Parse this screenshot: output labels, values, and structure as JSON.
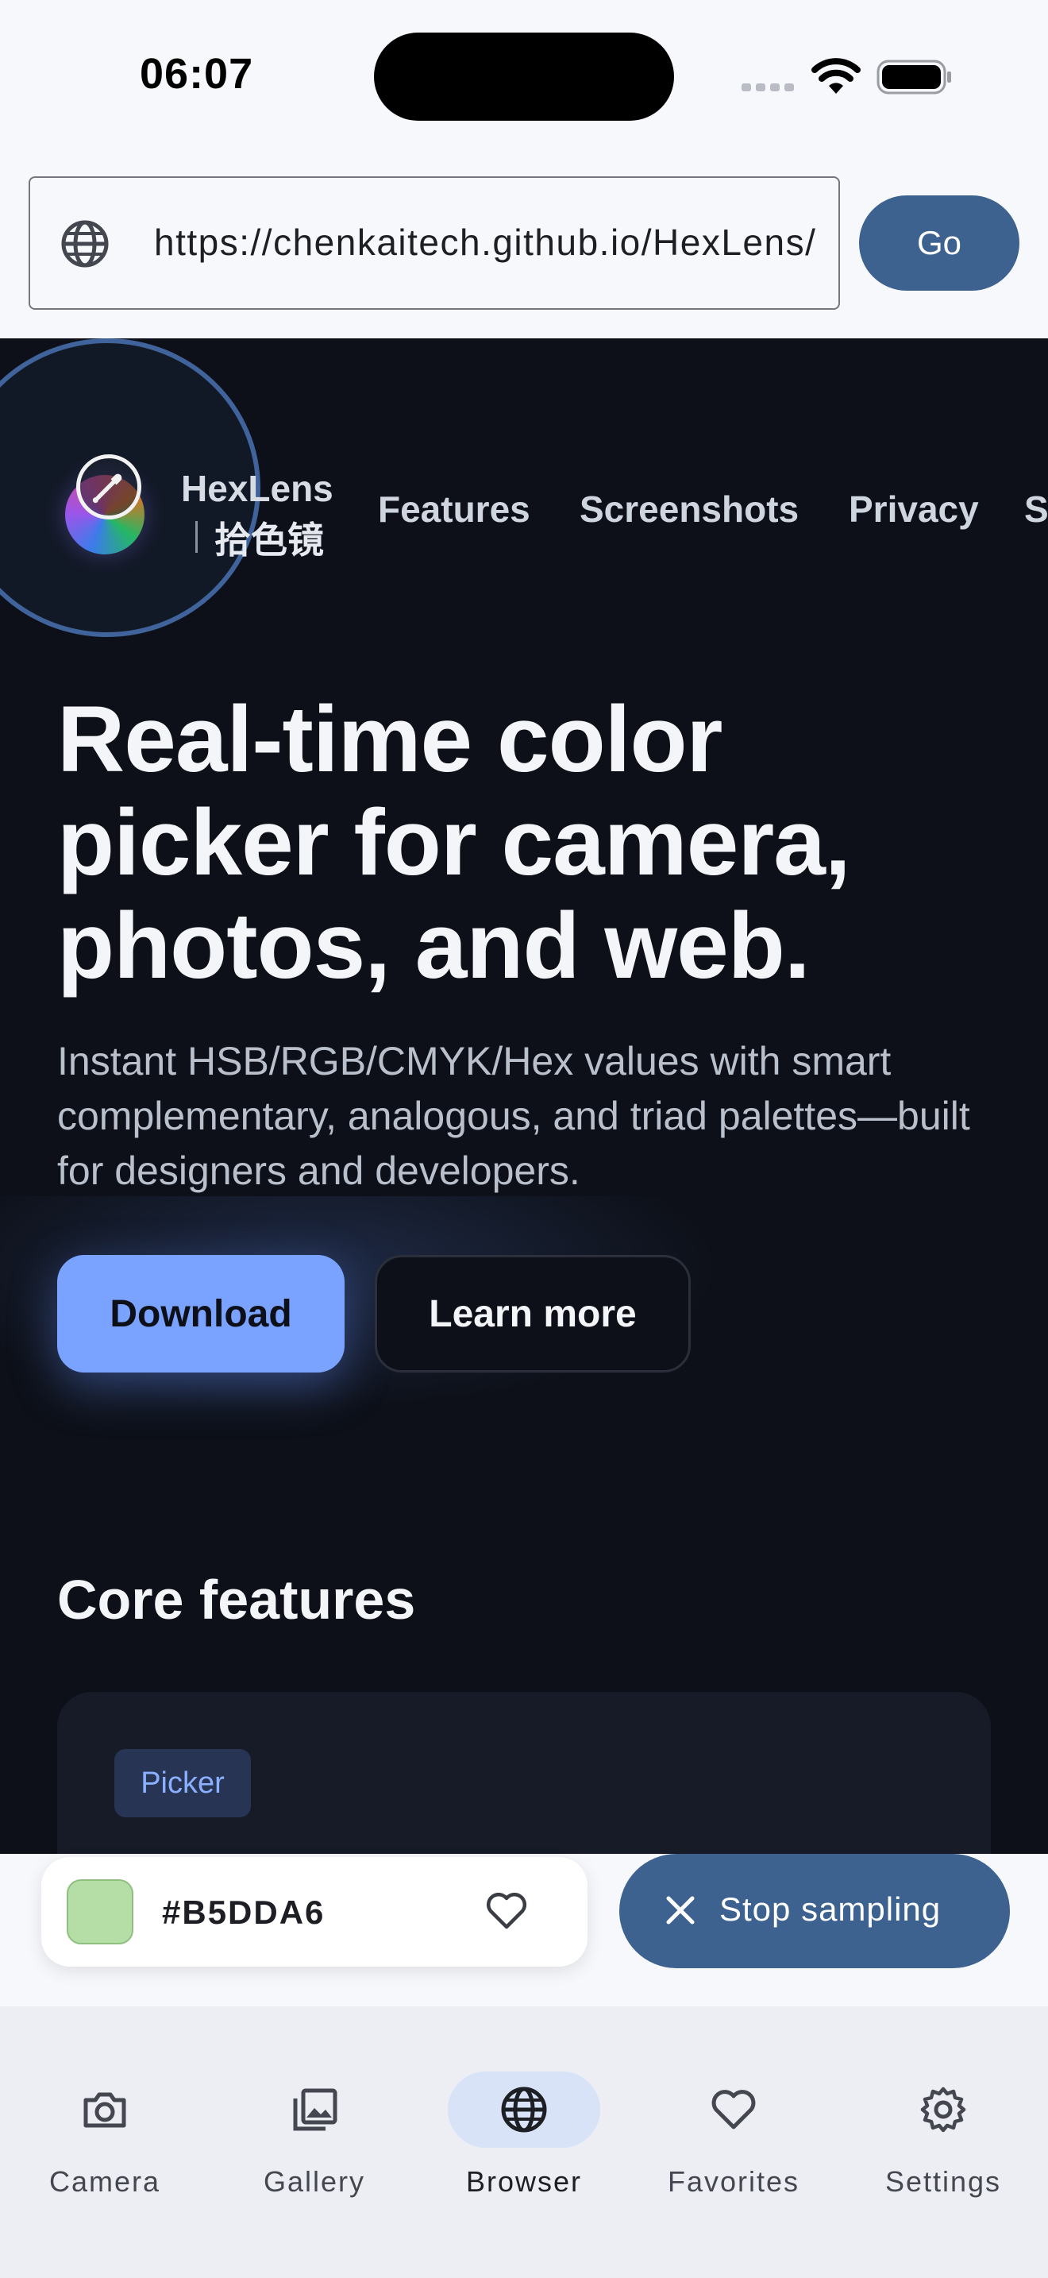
{
  "status_bar": {
    "time": "06:07"
  },
  "url_bar": {
    "url": "https://chenkaitech.github.io/HexLens/",
    "go_label": "Go"
  },
  "page": {
    "brand_en": "HexLens",
    "brand_cn": "拾色镜",
    "nav": [
      "Features",
      "Screenshots",
      "Privacy",
      "S"
    ],
    "hero_title": "Real-time color picker for camera, photos, and web.",
    "hero_subtitle": "Instant HSB/RGB/CMYK/Hex values with smart complementary, analogous, and triad palettes—built for designers and developers.",
    "download_label": "Download",
    "learn_more_label": "Learn more",
    "core_title": "Core features",
    "feature_tag": "Picker"
  },
  "sampling": {
    "hex": "#B5DDA6",
    "swatch_color": "#B5DDA6",
    "stop_label": "Stop sampling"
  },
  "bottom_nav": {
    "items": [
      {
        "label": "Camera",
        "icon": "camera-icon"
      },
      {
        "label": "Gallery",
        "icon": "gallery-icon"
      },
      {
        "label": "Browser",
        "icon": "globe-icon",
        "active": true
      },
      {
        "label": "Favorites",
        "icon": "heart-icon"
      },
      {
        "label": "Settings",
        "icon": "gear-icon"
      }
    ]
  },
  "colors": {
    "accent": "#3E628F",
    "web_bg": "#0D1018",
    "download_btn": "#7AA2FF"
  }
}
